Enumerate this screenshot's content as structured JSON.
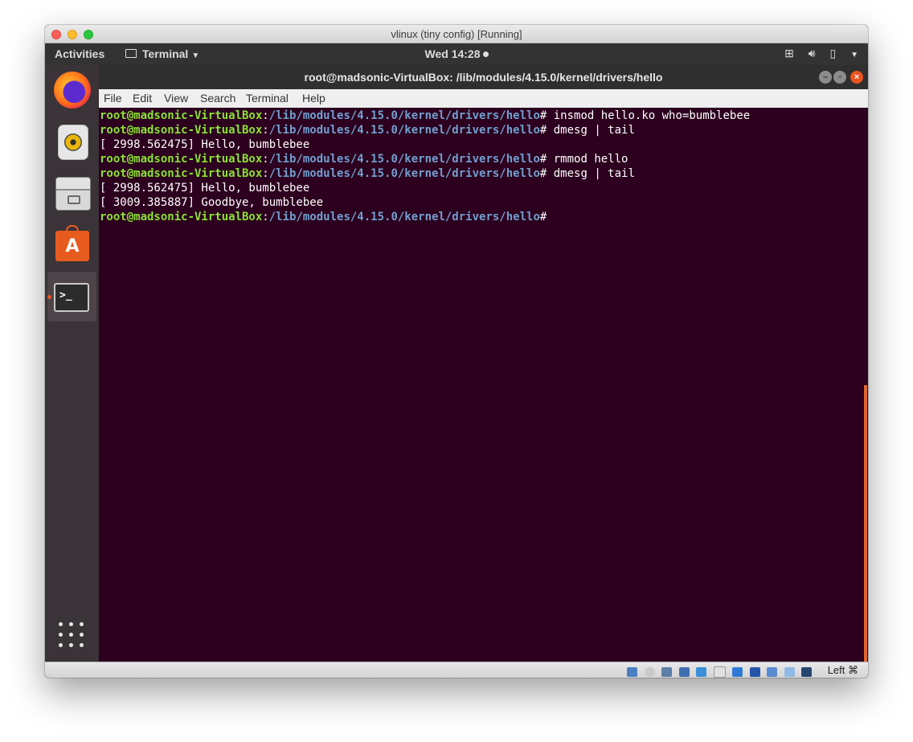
{
  "host_window": {
    "title": "vlinux (tiny config) [Running]"
  },
  "top_panel": {
    "activities": "Activities",
    "app_menu": "Terminal",
    "clock": "Wed 14:28"
  },
  "dock": {
    "items": [
      "firefox",
      "rhythmbox",
      "files",
      "ubuntu-software",
      "terminal"
    ]
  },
  "terminal": {
    "title": "root@madsonic-VirtualBox: /lib/modules/4.15.0/kernel/drivers/hello",
    "menu": [
      "File",
      "Edit",
      "View",
      "Search",
      "Terminal",
      "Help"
    ],
    "prompt_user": "root@madsonic-VirtualBox",
    "prompt_path": "/lib/modules/4.15.0/kernel/drivers/hello",
    "lines": [
      {
        "kind": "prompt",
        "cmd": " insmod hello.ko who=bumblebee"
      },
      {
        "kind": "prompt",
        "cmd": " dmesg | tail"
      },
      {
        "kind": "output",
        "text": "[ 2998.562475] Hello, bumblebee"
      },
      {
        "kind": "prompt",
        "cmd": " rmmod hello"
      },
      {
        "kind": "prompt",
        "cmd": " dmesg | tail"
      },
      {
        "kind": "output",
        "text": "[ 2998.562475] Hello, bumblebee"
      },
      {
        "kind": "output",
        "text": "[ 3009.385887] Goodbye, bumblebee"
      },
      {
        "kind": "prompt",
        "cmd": ""
      }
    ]
  },
  "status_bar": {
    "host_key": "Left ⌘"
  },
  "colors": {
    "terminal_bg": "#2c001e",
    "prompt_user": "#8ae234",
    "prompt_path": "#729fcf",
    "accent": "#e95420"
  }
}
